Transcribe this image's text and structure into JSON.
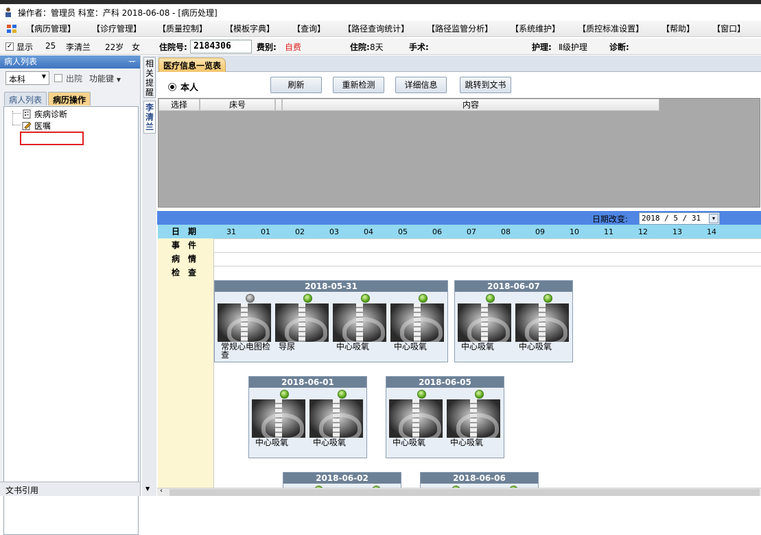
{
  "title": {
    "text": "操作者：管理员  科室：产科  2018-06-08 - [病历处理]"
  },
  "menu": {
    "items": [
      "【病历管理】",
      "【诊疗管理】",
      "【质量控制】",
      "【模板字典】",
      "【查询】",
      "【路径查询统计】",
      "【路径监管分析】",
      "【系统维护】",
      "【质控标准设置】",
      "【帮助】",
      "【窗口】"
    ]
  },
  "patient_bar": {
    "show_label": "显示",
    "bed": "25",
    "name": "李清兰",
    "age": "22岁",
    "sex": "女",
    "admission_no_label": "住院号:",
    "admission_no": "2184306",
    "fee_label": "费别:",
    "fee": "自费",
    "stay_label": "住院:",
    "stay": "8天",
    "surgery_label": "手术:",
    "nursing_label": "护理:",
    "nursing": "Ⅱ级护理",
    "diagnosis_label": "诊断:"
  },
  "left_panel": {
    "title": "病人列表",
    "pin": "ᅲ",
    "dept_select": "本科",
    "discharge_label": "出院",
    "function_key": "功能键",
    "tabs": [
      "病人列表",
      "病历操作"
    ],
    "tree": [
      "疾病诊断",
      "医嘱"
    ],
    "bottom": "文书引用"
  },
  "side_tabs": [
    "相关提醒",
    "李清兰"
  ],
  "main": {
    "tab": "医疗信息一览表",
    "radio_label": "本人",
    "buttons": [
      "刷新",
      "重新检测",
      "详细信息",
      "跳转到文书"
    ],
    "grid_headers": [
      "选择",
      "床号",
      "内容"
    ]
  },
  "timeline": {
    "date_change_label": "日期改变:",
    "date_value": "2018 / 5 / 31",
    "row_labels": [
      "日期",
      "事件",
      "病情",
      "检查"
    ],
    "days": [
      "31",
      "01",
      "02",
      "03",
      "04",
      "05",
      "06",
      "07",
      "08",
      "09",
      "10",
      "11",
      "12",
      "13",
      "14"
    ],
    "groups": [
      {
        "date": "2018-05-31",
        "items": [
          {
            "caption": "常规心电图检查",
            "status": "gray"
          },
          {
            "caption": "导尿",
            "status": "green"
          },
          {
            "caption": "中心吸氧",
            "status": "green"
          },
          {
            "caption": "中心吸氧",
            "status": "green"
          }
        ]
      },
      {
        "date": "2018-06-07",
        "items": [
          {
            "caption": "中心吸氧",
            "status": "green"
          },
          {
            "caption": "中心吸氧",
            "status": "green"
          }
        ]
      },
      {
        "date": "2018-06-01",
        "items": [
          {
            "caption": "中心吸氧",
            "status": "green"
          },
          {
            "caption": "中心吸氧",
            "status": "green"
          }
        ]
      },
      {
        "date": "2018-06-05",
        "items": [
          {
            "caption": "中心吸氧",
            "status": "green"
          },
          {
            "caption": "中心吸氧",
            "status": "green"
          }
        ]
      },
      {
        "date": "2018-06-02",
        "items": []
      },
      {
        "date": "2018-06-06",
        "items": []
      }
    ]
  },
  "colors": {
    "accent_blue": "#4f86e4",
    "date_row": "#91d8f0",
    "label_col": "#fdf6d2",
    "tab_active": "#f6d28c",
    "fee_red": "#e02020"
  }
}
